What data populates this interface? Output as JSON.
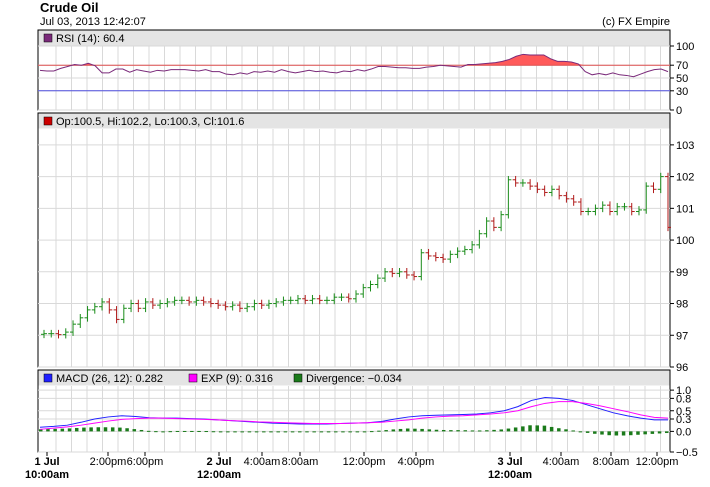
{
  "header": {
    "title": "Crude Oil",
    "timestamp": "Jul 03, 2013 12:42:07",
    "copyright": "(c) FX Empire"
  },
  "colors": {
    "grid": "#d9d9d9",
    "legend_bg": "#e4e4e4",
    "up_candle": "#1a8c1a",
    "down_candle": "#b01a1a",
    "rsi_line": "#7a2a7a",
    "rsi_fill": "#ff5a5a",
    "rsi_upper_line": "#e05050",
    "rsi_lower_line": "#5050e0",
    "macd_line": "#2020ff",
    "exp_line": "#ff00ff",
    "divergence": "#1a7a1a"
  },
  "chart_data": [
    {
      "type": "line",
      "panel": "rsi",
      "legend": "RSI (14): 60.4",
      "legend_color": "#7a2a7a",
      "yticks": [
        0,
        30,
        50,
        70,
        100
      ],
      "ylim": [
        0,
        100
      ],
      "reference_lines": [
        70,
        30
      ],
      "values": [
        62,
        61,
        61,
        65,
        68,
        71,
        70,
        73,
        69,
        58,
        58,
        64,
        64,
        59,
        63,
        61,
        59,
        62,
        61,
        63,
        63,
        63,
        62,
        61,
        63,
        60,
        60,
        56,
        55,
        58,
        56,
        60,
        59,
        61,
        59,
        63,
        60,
        58,
        60,
        62,
        60,
        61,
        59,
        58,
        61,
        60,
        63,
        61,
        64,
        68,
        68,
        67,
        66,
        66,
        65,
        65,
        67,
        68,
        70,
        69,
        68,
        67,
        71,
        71,
        72,
        73,
        74,
        76,
        79,
        84,
        87,
        86,
        86,
        86,
        80,
        76,
        76,
        75,
        72,
        60,
        55,
        57,
        55,
        58,
        55,
        54,
        52,
        56,
        60,
        63,
        64,
        60
      ]
    },
    {
      "type": "candlestick",
      "panel": "price",
      "legend": "Op:100.5, Hi:102.2, Lo:100.3, Cl:101.6",
      "legend_color": "#cc0000",
      "yticks": [
        96,
        97,
        98,
        99,
        100,
        101,
        102,
        103
      ],
      "ylim": [
        96,
        103.5
      ],
      "x_labels": [
        {
          "label": "1 Jul",
          "sub": "10:00am",
          "bold": true
        },
        {
          "label": "2:00pm"
        },
        {
          "label": "6:00pm"
        },
        {
          "label": "2 Jul",
          "sub": "12:00am",
          "bold": true
        },
        {
          "label": "4:00am"
        },
        {
          "label": "8:00am"
        },
        {
          "label": "12:00pm"
        },
        {
          "label": "4:00pm"
        },
        {
          "label": "3 Jul",
          "sub": "12:00am",
          "bold": true
        },
        {
          "label": "4:00am"
        },
        {
          "label": "8:00am"
        },
        {
          "label": "12:00pm"
        }
      ],
      "closes": [
        97.05,
        97.05,
        97.02,
        97.1,
        97.35,
        97.55,
        97.8,
        97.9,
        98.05,
        97.8,
        97.5,
        97.85,
        98.0,
        97.85,
        98.05,
        97.95,
        98.0,
        98.05,
        98.1,
        98.1,
        98.05,
        98.1,
        98.05,
        98.0,
        97.95,
        97.9,
        97.95,
        97.85,
        97.9,
        98.0,
        97.95,
        98.0,
        98.05,
        98.1,
        98.1,
        98.15,
        98.1,
        98.15,
        98.1,
        98.1,
        98.2,
        98.2,
        98.15,
        98.3,
        98.5,
        98.6,
        98.8,
        99.0,
        98.95,
        99.0,
        98.9,
        98.85,
        99.6,
        99.5,
        99.45,
        99.4,
        99.55,
        99.65,
        99.7,
        99.85,
        100.2,
        100.6,
        100.4,
        100.8,
        101.9,
        101.8,
        101.8,
        101.7,
        101.6,
        101.5,
        101.6,
        101.4,
        101.3,
        101.2,
        100.9,
        100.9,
        101.0,
        101.1,
        100.9,
        101.05,
        101.05,
        100.9,
        100.95,
        101.7,
        101.6,
        102.0,
        100.4
      ]
    },
    {
      "type": "line",
      "panel": "macd",
      "legend_items": [
        {
          "label": "MACD (26, 12): 0.282",
          "color": "#2020ff"
        },
        {
          "label": "EXP (9): 0.316",
          "color": "#ff00ff"
        },
        {
          "label": "Divergence: −0.034",
          "color": "#1a7a1a"
        }
      ],
      "yticks": [
        -0.5,
        0.0,
        0.3,
        0.5,
        0.8,
        1.0
      ],
      "ytick_labels": [
        "−0.5",
        "0.0",
        "0.3",
        "0.5",
        "0.8",
        "1.0"
      ],
      "ylim": [
        -0.5,
        1.1
      ],
      "series": [
        {
          "name": "MACD (26, 12)",
          "values": [
            0.1,
            0.12,
            0.15,
            0.22,
            0.3,
            0.35,
            0.38,
            0.36,
            0.33,
            0.32,
            0.32,
            0.31,
            0.3,
            0.28,
            0.26,
            0.24,
            0.22,
            0.2,
            0.19,
            0.18,
            0.18,
            0.18,
            0.19,
            0.2,
            0.21,
            0.24,
            0.3,
            0.35,
            0.38,
            0.39,
            0.4,
            0.41,
            0.42,
            0.45,
            0.5,
            0.6,
            0.75,
            0.82,
            0.8,
            0.75,
            0.65,
            0.55,
            0.45,
            0.38,
            0.32,
            0.28,
            0.28
          ]
        },
        {
          "name": "EXP (9)",
          "values": [
            0.05,
            0.08,
            0.11,
            0.15,
            0.2,
            0.25,
            0.29,
            0.31,
            0.32,
            0.32,
            0.31,
            0.3,
            0.29,
            0.28,
            0.26,
            0.25,
            0.23,
            0.22,
            0.21,
            0.2,
            0.19,
            0.19,
            0.19,
            0.2,
            0.21,
            0.22,
            0.25,
            0.28,
            0.32,
            0.35,
            0.37,
            0.38,
            0.4,
            0.42,
            0.45,
            0.5,
            0.6,
            0.68,
            0.72,
            0.72,
            0.68,
            0.62,
            0.55,
            0.48,
            0.4,
            0.34,
            0.32
          ]
        },
        {
          "name": "Divergence",
          "values": [
            0.05,
            0.06,
            0.07,
            0.09,
            0.1,
            0.1,
            0.09,
            0.05,
            0.01,
            0.0,
            0.01,
            0.01,
            0.01,
            0.0,
            0.0,
            -0.01,
            -0.01,
            -0.02,
            -0.02,
            -0.02,
            -0.01,
            -0.01,
            0.0,
            0.0,
            0.0,
            0.02,
            0.05,
            0.07,
            0.06,
            0.04,
            0.03,
            0.03,
            0.02,
            0.03,
            0.05,
            0.1,
            0.15,
            0.14,
            0.08,
            0.03,
            -0.03,
            -0.07,
            -0.1,
            -0.1,
            -0.08,
            -0.06,
            -0.04
          ]
        }
      ]
    }
  ]
}
